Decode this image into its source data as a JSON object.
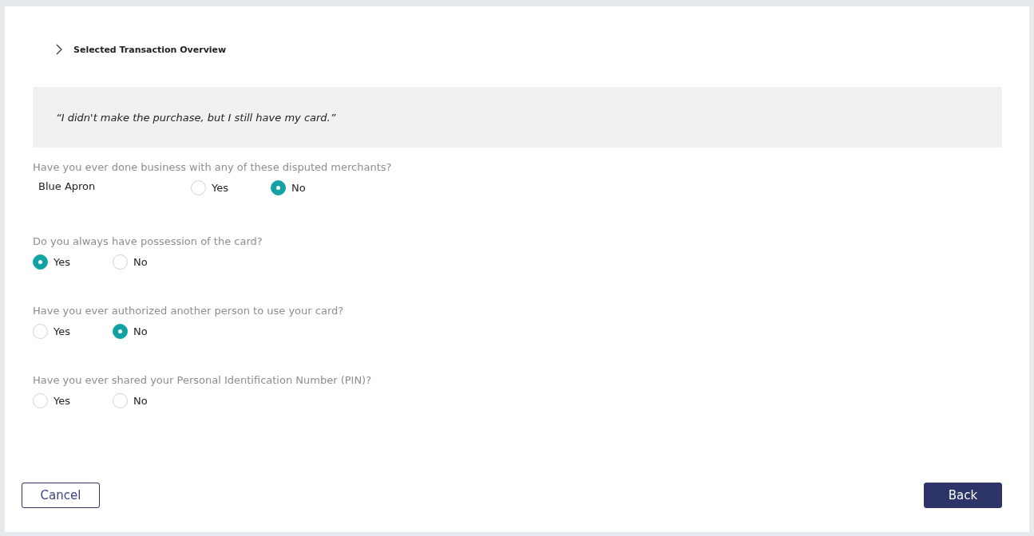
{
  "overview": {
    "title": "Selected Transaction Overview",
    "expanded": false
  },
  "quote": "“I didn't make the purchase, but I still have my card.”",
  "questions": [
    {
      "kind": "merchant",
      "prompt": "Have you ever done business with any of these disputed merchants?",
      "merchant": "Blue Apron",
      "options": [
        {
          "label": "Yes",
          "selected": false
        },
        {
          "label": "No",
          "selected": true
        }
      ]
    },
    {
      "kind": "yesno",
      "prompt": "Do you always have possession of the card?",
      "options": [
        {
          "label": "Yes",
          "selected": true
        },
        {
          "label": "No",
          "selected": false
        }
      ]
    },
    {
      "kind": "yesno",
      "prompt": "Have you ever authorized another person to use your card?",
      "options": [
        {
          "label": "Yes",
          "selected": false
        },
        {
          "label": "No",
          "selected": true
        }
      ]
    },
    {
      "kind": "yesno",
      "prompt": "Have you ever shared your Personal Identification Number (PIN)?",
      "options": [
        {
          "label": "Yes",
          "selected": false
        },
        {
          "label": "No",
          "selected": false
        }
      ]
    }
  ],
  "buttons": {
    "cancel": "Cancel",
    "back": "Back"
  }
}
